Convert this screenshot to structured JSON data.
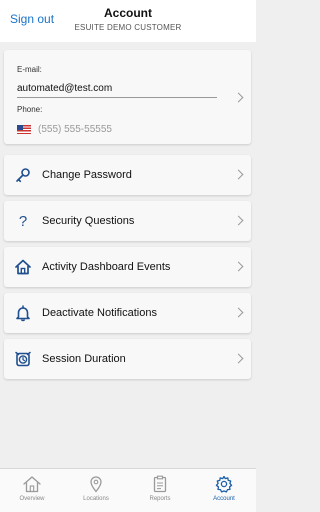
{
  "header": {
    "sign_out": "Sign out",
    "title": "Account",
    "subtitle": "ESUITE DEMO CUSTOMER"
  },
  "profile": {
    "email_label": "E-mail:",
    "email_value": "automated@test.com",
    "phone_label": "Phone:",
    "phone_placeholder": "(555) 555-55555"
  },
  "menu": {
    "items": [
      {
        "label": "Change Password",
        "icon": "key-icon"
      },
      {
        "label": "Security Questions",
        "icon": "question-icon"
      },
      {
        "label": "Activity Dashboard Events",
        "icon": "home-icon"
      },
      {
        "label": "Deactivate Notifications",
        "icon": "bell-icon"
      },
      {
        "label": "Session Duration",
        "icon": "alarm-clock-icon"
      }
    ]
  },
  "tabs": [
    {
      "label": "Overview",
      "icon": "home-icon",
      "active": false
    },
    {
      "label": "Locations",
      "icon": "location-pin-icon",
      "active": false
    },
    {
      "label": "Reports",
      "icon": "clipboard-icon",
      "active": false
    },
    {
      "label": "Account",
      "icon": "gear-icon",
      "active": true
    }
  ],
  "colors": {
    "accent": "#1a73c9",
    "icon_blue": "#1f4f8f",
    "background": "#efefef"
  }
}
